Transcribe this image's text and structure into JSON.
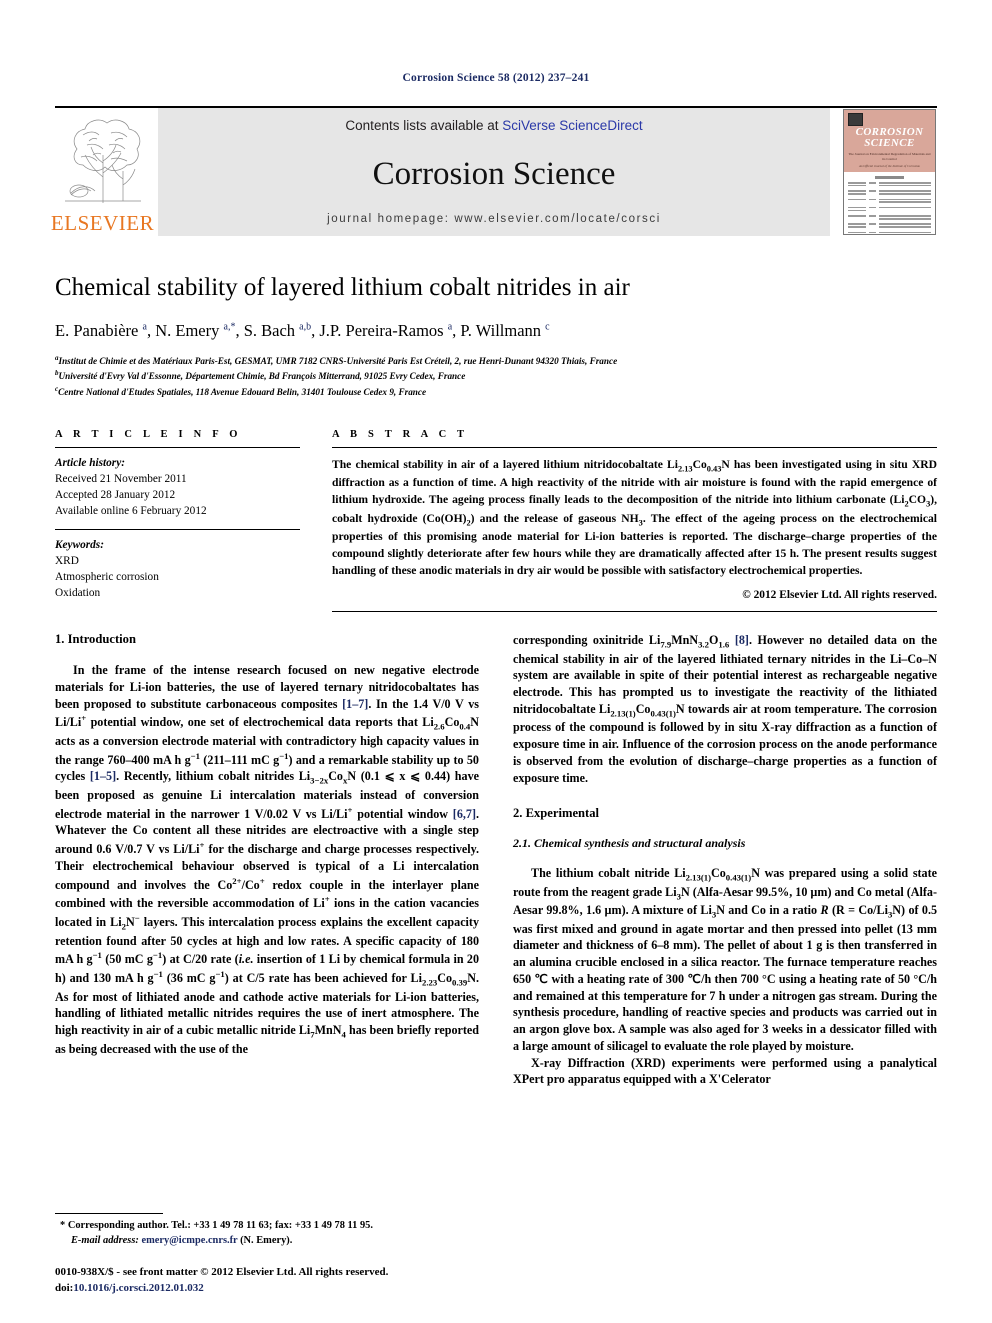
{
  "running_head": "Corrosion Science 58 (2012) 237–241",
  "masthead": {
    "contents_prefix": "Contents lists available at ",
    "sciencedirect": "SciVerse ScienceDirect",
    "journal_title": "Corrosion Science",
    "homepage": "journal homepage: www.elsevier.com/locate/corsci",
    "publisher": "ELSEVIER",
    "cover": {
      "line1": "CORROSION",
      "line2": "SCIENCE",
      "subtitle": "The Journal on Environmental Degradation of Materials and its Control",
      "subtitle2": "An Official Journal of the Institute of Corrosion"
    },
    "band_color": "#e6e6e6",
    "link_color": "#2b39a8",
    "elsevier_orange": "#e87722",
    "cover_color": "#d9a79a"
  },
  "title": "Chemical stability of layered lithium cobalt nitrides in air",
  "authors_html": "E. Panabière <sup>a</sup>, N. Emery <sup>a,*</sup>, S. Bach <sup>a,b</sup>, J.P. Pereira-Ramos <sup>a</sup>, P. Willmann <sup>c</sup>",
  "affiliations": [
    {
      "marker": "a",
      "text": "Institut de Chimie et des Matériaux Paris-Est, GESMAT, UMR 7182 CNRS-Université Paris Est Créteil, 2, rue Henri-Dunant 94320 Thiais, France"
    },
    {
      "marker": "b",
      "text": "Université d'Evry Val d'Essonne, Département Chimie, Bd François Mitterrand, 91025 Evry Cedex, France"
    },
    {
      "marker": "c",
      "text": "Centre National d'Etudes Spatiales, 118 Avenue Edouard Belin, 31401 Toulouse Cedex 9, France"
    }
  ],
  "article_info": {
    "heading": "A R T I C L E   I N F O",
    "history_label": "Article history:",
    "history": [
      "Received 21 November 2011",
      "Accepted 28 January 2012",
      "Available online 6 February 2012"
    ],
    "keywords_label": "Keywords:",
    "keywords": [
      "XRD",
      "Atmospheric corrosion",
      "Oxidation"
    ]
  },
  "abstract": {
    "heading": "A B S T R A C T",
    "body_html": "The chemical stability in air of a layered lithium nitridocobaltate Li<sub>2.13</sub>Co<sub>0.43</sub>N has been investigated using in situ XRD diffraction as a function of time. A high reactivity of the nitride with air moisture is found with the rapid emergence of lithium hydroxide. The ageing process finally leads to the decomposition of the nitride into lithium carbonate (Li<sub>2</sub>CO<sub>3</sub>), cobalt hydroxide (Co(OH)<sub>2</sub>) and the release of gaseous NH<sub>3</sub>. The effect of the ageing process on the electrochemical properties of this promising anode material for Li-ion batteries is reported. The discharge–charge properties of the compound slightly deteriorate after few hours while they are dramatically affected after 15 h. The present results suggest handling of these anodic materials in dry air would be possible with satisfactory electrochemical properties.",
    "copyright": "© 2012 Elsevier Ltd. All rights reserved."
  },
  "sections": {
    "introduction_heading": "1. Introduction",
    "intro_p1_html": "In the frame of the intense research focused on new negative electrode materials for Li-ion batteries, the use of layered ternary nitridocobaltates has been proposed to substitute carbonaceous composites <span class=\"ref\">[1–7]</span>. In the 1.4 V/0 V vs Li/Li<sup>+</sup> potential window, one set of electrochemical data reports that Li<sub>2.6</sub>Co<sub>0.4</sub>N acts as a conversion electrode material with contradictory high capacity values in the range 760–400 mA h g<sup>−1</sup> (211–111 mC g<sup>−1</sup>) and a remarkable stability up to 50 cycles <span class=\"ref\">[1–5]</span>. Recently, lithium cobalt nitrides Li<sub>3−2x</sub>Co<sub>x</sub>N (0.1 ⩽ x ⩽ 0.44) have been proposed as genuine Li intercalation materials instead of conversion electrode material in the narrower 1 V/0.02 V vs Li/Li<sup>+</sup> potential window <span class=\"ref\">[6,7]</span>. Whatever the Co content all these nitrides are electroactive with a single step around 0.6 V/0.7 V vs Li/Li<sup>+</sup> for the discharge and charge processes respectively. Their electrochemical behaviour observed is typical of a Li intercalation compound and involves the Co<sup>2+</sup>/Co<sup>+</sup> redox couple in the interlayer plane combined with the reversible accommodation of Li<sup>+</sup> ions in the cation vacancies located in Li<sub>2</sub>N<sup>−</sup> layers. This intercalation process explains the excellent capacity retention found after 50 cycles at high and low rates. A specific capacity of 180 mA h g<sup>−1</sup> (50 mC g<sup>−1</sup>) at C/20 rate (<i>i.e.</i> insertion of 1 Li by chemical formula in 20 h) and 130 mA h g<sup>−1</sup> (36 mC g<sup>−1</sup>) at C/5 rate has been achieved for Li<sub>2.23</sub>Co<sub>0.39</sub>N. As for most of lithiated anode and cathode active materials for Li-ion batteries, handling of lithiated metallic nitrides requires the use of inert atmosphere. The high reactivity in air of a cubic metallic nitride Li<sub>7</sub>MnN<sub>4</sub> has been briefly reported as being decreased with the use of the",
    "intro_p1_cont_html": "corresponding oxinitride Li<sub>7.9</sub>MnN<sub>3.2</sub>O<sub>1.6</sub> <span class=\"ref\">[8]</span>. However no detailed data on the chemical stability in air of the layered lithiated ternary nitrides in the Li–Co–N system are available in spite of their potential interest as rechargeable negative electrode. This has prompted us to investigate the reactivity of the lithiated nitridocobaltate Li<sub>2.13(1)</sub>Co<sub>0.43(1)</sub>N towards air at room temperature. The corrosion process of the compound is followed by in situ X-ray diffraction as a function of exposure time in air. Influence of the corrosion process on the anode performance is observed from the evolution of discharge–charge properties as a function of exposure time.",
    "experimental_heading": "2. Experimental",
    "subsection_heading": "2.1. Chemical synthesis and structural analysis",
    "exp_p1_html": "The lithium cobalt nitride Li<sub>2.13(1)</sub>Co<sub>0.43(1)</sub>N was prepared using a solid state route from the reagent grade Li<sub>3</sub>N (Alfa-Aesar 99.5%, 10 µm) and Co metal (Alfa-Aesar 99.8%, 1.6 µm). A mixture of Li<sub>3</sub>N and Co in a ratio <i>R</i> (R = Co/Li<sub>3</sub>N) of 0.5 was first mixed and ground in agate mortar and then pressed into pellet (13 mm diameter and thickness of 6–8 mm). The pellet of about 1 g is then transferred in an alumina crucible enclosed in a silica reactor. The furnace temperature reaches 650 ℃ with a heating rate of 300 ℃/h then 700 °C using a heating rate of 50 °C/h and remained at this temperature for 7 h under a nitrogen gas stream. During the synthesis procedure, handling of reactive species and products was carried out in an argon glove box. A sample was also aged for 3 weeks in a dessicator filled with a large amount of silicagel to evaluate the role played by moisture.",
    "exp_p2_html": "X-ray Diffraction (XRD) experiments were performed using a panalytical XPert pro apparatus equipped with a X'Celerator"
  },
  "footnote": {
    "corresponding_marker": "*",
    "corresponding_text": "Corresponding author. Tel.: +33 1 49 78 11 63; fax: +33 1 49 78 11 95.",
    "email_label": "E-mail address:",
    "email": "emery@icmpe.cnrs.fr",
    "email_suffix": "(N. Emery).",
    "issn_line": "0010-938X/$ - see front matter © 2012 Elsevier Ltd. All rights reserved.",
    "doi_label": "doi:",
    "doi": "10.1016/j.corsci.2012.01.032"
  }
}
